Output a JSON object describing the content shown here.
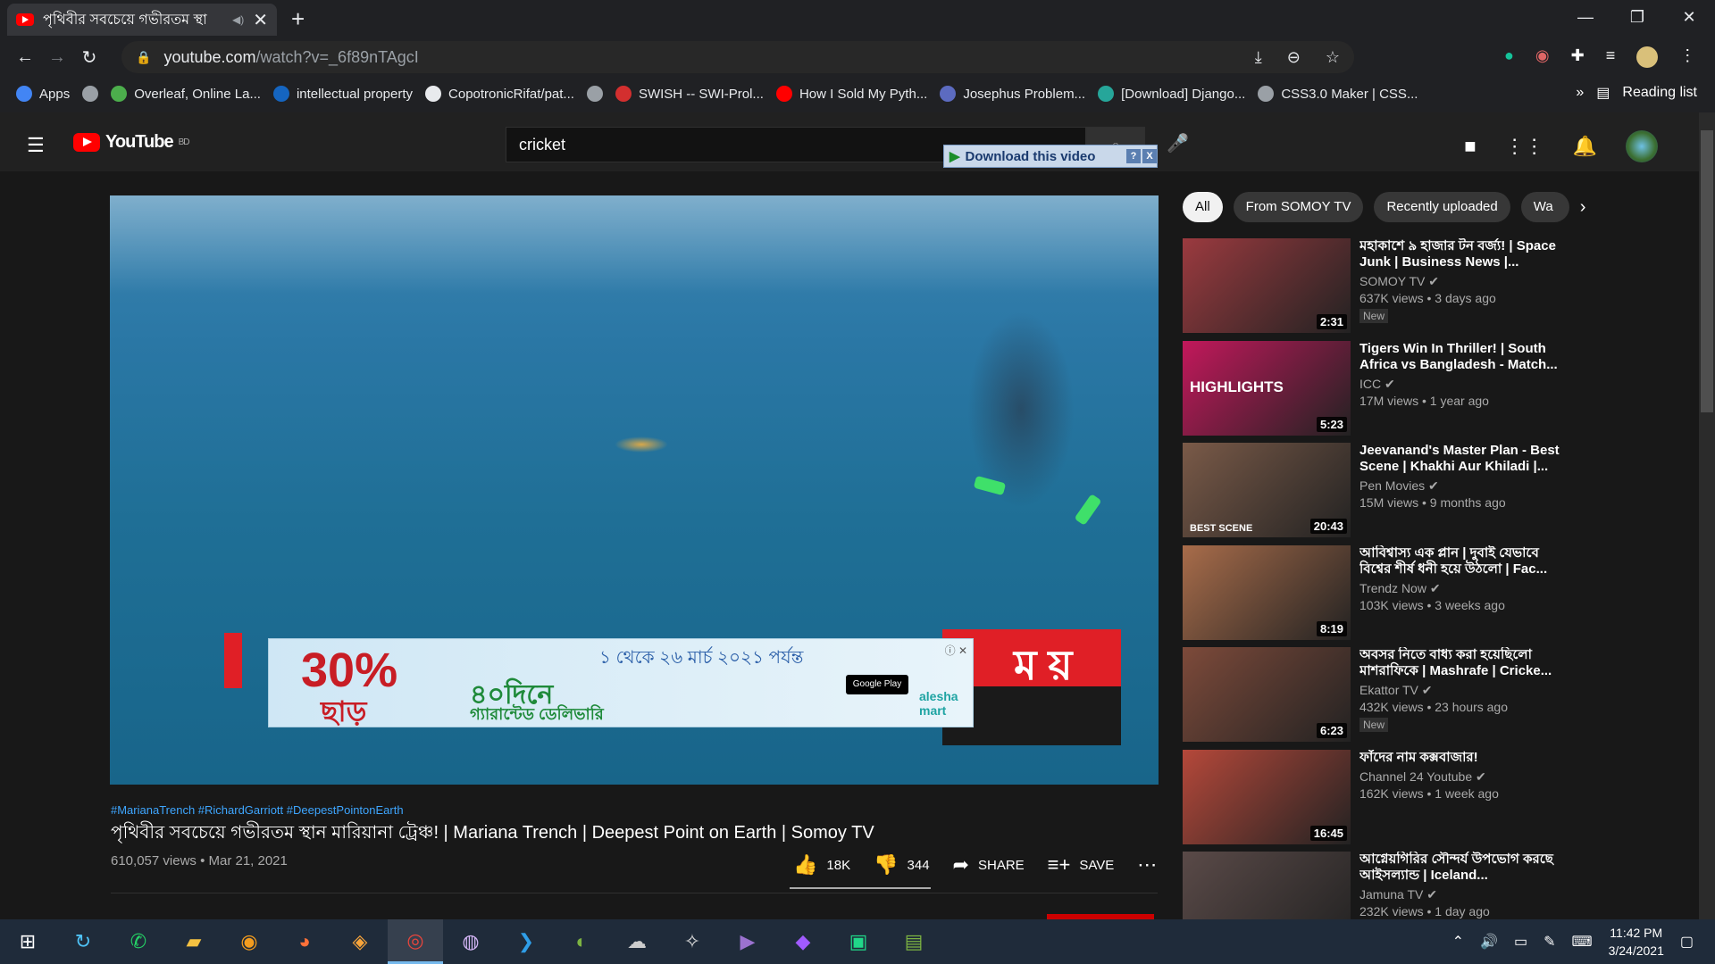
{
  "browser": {
    "tab_title": "পৃথিবীর সবচেয়ে গভীরতম স্থা",
    "tab_mute": "◀)",
    "url_host": "youtube.com",
    "url_path": "/watch?v=_6f89nTAgcI",
    "bookmarks": [
      {
        "label": "Apps",
        "color": "#4285f4"
      },
      {
        "label": "",
        "color": "#9aa0a6"
      },
      {
        "label": "Overleaf, Online La...",
        "color": "#4cae4c"
      },
      {
        "label": "intellectual property",
        "color": "#1565c0"
      },
      {
        "label": "CopotronicRifat/pat...",
        "color": "#e8eaed"
      },
      {
        "label": "",
        "color": "#9aa0a6"
      },
      {
        "label": "SWISH -- SWI-Prol...",
        "color": "#d32f2f"
      },
      {
        "label": "How I Sold My Pyth...",
        "color": "#ff0000"
      },
      {
        "label": "Josephus Problem...",
        "color": "#5c6bc0"
      },
      {
        "label": "[Download] Django...",
        "color": "#26a69a"
      },
      {
        "label": "CSS3.0 Maker | CSS...",
        "color": "#9aa0a6"
      }
    ],
    "bookmarks_more": "»",
    "reading_list": "Reading list"
  },
  "youtube": {
    "logo_text": "YouTube",
    "logo_region": "BD",
    "search_value": "cricket",
    "download_label": "Download this video",
    "download_help": "?",
    "download_close": "X"
  },
  "video": {
    "ad_percent": "30%",
    "ad_chhar": "ছাড়",
    "ad_date": "১ থেকে ২৬ মার্চ ২০২১ পর্যন্ত",
    "ad_days": "৪০দিনে",
    "ad_delivery": "গ্যারান্টেড ডেলিভারি",
    "ad_gplay": "Google Play",
    "ad_brand": "alesha mart",
    "somoy_letters": "ম য়",
    "hashtags": "#MarianaTrench #RichardGarriott #DeepestPointonEarth",
    "title": "পৃথিবীর সবচেয়ে গভীরতম স্থান মারিয়ানা ট্রেঞ্চ! | Mariana Trench | Deepest Point on Earth | Somoy TV",
    "meta": "610,057 views • Mar 21, 2021",
    "likes": "18K",
    "dislikes": "344",
    "share": "SHARE",
    "save": "SAVE"
  },
  "chips": [
    "All",
    "From SOMOY TV",
    "Recently uploaded",
    "Wa"
  ],
  "recommendations": [
    {
      "title": "মহাকাশে ৯ হাজার টন বর্জ্য! | Space Junk | Business News |...",
      "channel": "SOMOY TV",
      "views": "637K views • 3 days ago",
      "duration": "2:31",
      "badge": "New",
      "bg": "#9b3a3f"
    },
    {
      "title": "Tigers Win In Thriller! | South Africa vs Bangladesh - Match...",
      "channel": "ICC",
      "views": "17M views • 1 year ago",
      "duration": "5:23",
      "badge": "",
      "bg": "#c2185b",
      "overlay": "HIGHLIGHTS"
    },
    {
      "title": "Jeevanand's Master Plan - Best Scene | Khakhi Aur Khiladi |...",
      "channel": "Pen Movies",
      "views": "15M views • 9 months ago",
      "duration": "20:43",
      "badge": "",
      "bg": "#7a5a48",
      "overlay": "BEST SCENE"
    },
    {
      "title": "আবিশ্বাস্য এক প্লান | দুবাই যেভাবে বিশ্বের শীর্ষ ধনী হয়ে উঠলো | Fac...",
      "channel": "Trendz Now",
      "views": "103K views • 3 weeks ago",
      "duration": "8:19",
      "badge": "",
      "bg": "#a86c4a"
    },
    {
      "title": "অবসর নিতে বাধ্য করা হয়েছিলো মাশরাফিকে | Mashrafe | Cricke...",
      "channel": "Ekattor TV",
      "views": "432K views • 23 hours ago",
      "duration": "6:23",
      "badge": "New",
      "bg": "#7d4a3a"
    },
    {
      "title": "ফাঁদের নাম কক্সবাজার!",
      "channel": "Channel 24 Youtube",
      "views": "162K views • 1 week ago",
      "duration": "16:45",
      "badge": "",
      "bg": "#b5483a"
    },
    {
      "title": "আগ্নেয়গিরির সৌন্দর্য উপভোগ করছে আইসল্যান্ড | Iceland...",
      "channel": "Jamuna TV",
      "views": "232K views • 1 day ago",
      "duration": "",
      "badge": "",
      "bg": "#5a4a48"
    }
  ],
  "taskbar": {
    "time": "11:42 PM",
    "date": "3/24/2021"
  }
}
